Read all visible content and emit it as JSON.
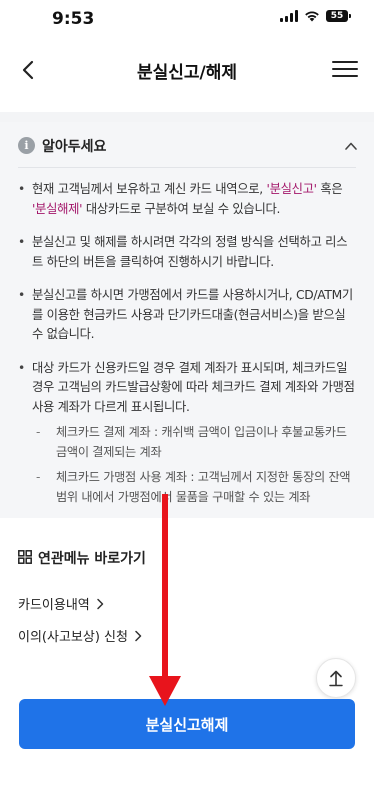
{
  "status_bar": {
    "time": "9:53",
    "battery": "55",
    "icons": [
      "signal-icon",
      "wifi-icon",
      "battery-icon"
    ]
  },
  "header": {
    "title": "분실신고/해제",
    "back_icon": "chevron-left-icon",
    "menu_icon": "hamburger-menu-icon"
  },
  "notice": {
    "title": "알아두세요",
    "items": [
      {
        "before": "현재 고객님께서 보유하고 계신 카드 내역으로, ",
        "hl1": "'분실신고'",
        "mid": " 혹은 ",
        "hl2": "'분실해제'",
        "after": " 대상카드로 구분하여 보실 수 있습니다."
      },
      {
        "text": "분실신고 및 해제를 하시려면 각각의 정렬 방식을 선택하고 리스트 하단의 버튼을 클릭하여 진행하시기 바랍니다."
      },
      {
        "text": "분실신고를 하시면 가맹점에서 카드를 사용하시거나, CD/ATM기를 이용한 현금카드 사용과 단기카드대출(현금서비스)을 받으실 수 없습니다."
      },
      {
        "text": "대상 카드가 신용카드일 경우 결제 계좌가 표시되며, 체크카드일 경우 고객님의 카드발급상황에 따라 체크카드 결제 계좌와 가맹점 사용 계좌가 다르게 표시됩니다."
      }
    ],
    "sub_items": [
      {
        "text": "체크카드 결제 계좌 : 캐쉬백 금액이 입금이나 후불교통카드 금액이 결제되는 계좌"
      },
      {
        "text": "체크카드 가맹점 사용 계좌 : 고객님께서 지정한 통장의 잔액 범위 내에서 가맹점에서 물품을 구매할 수 있는 계좌"
      }
    ]
  },
  "related_menu": {
    "title": "연관메뉴 바로가기",
    "links": [
      {
        "label": "카드이용내역"
      },
      {
        "label": "이의(사고보상) 신청"
      }
    ]
  },
  "actions": {
    "primary_label": "분실신고해제"
  },
  "colors": {
    "primary": "#1f73e8",
    "highlight": "#a3176a",
    "annotation_arrow": "#e8141c"
  }
}
